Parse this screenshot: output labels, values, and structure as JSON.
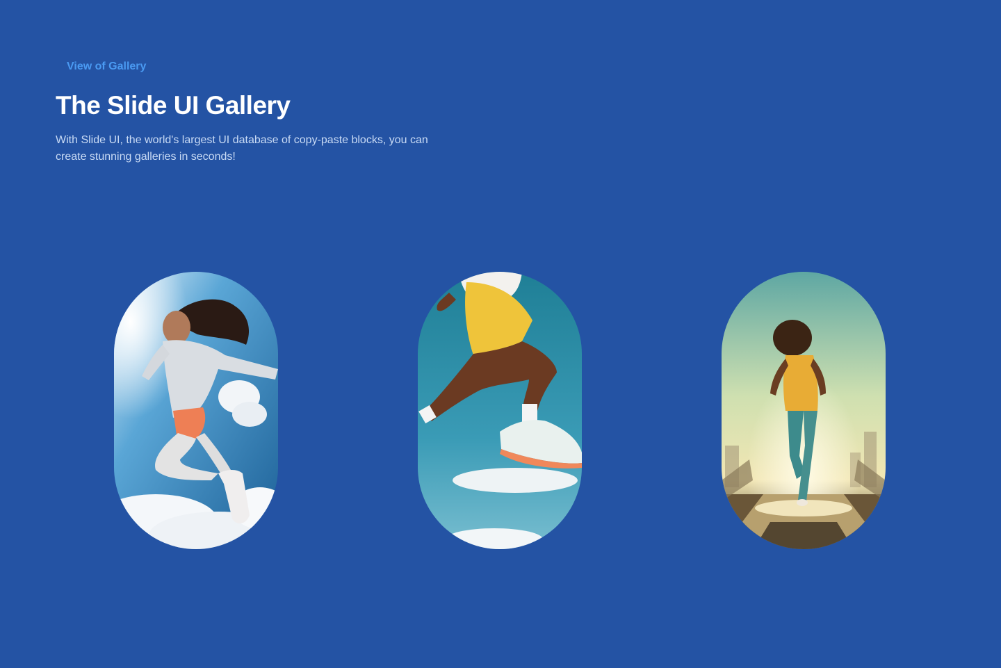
{
  "header": {
    "eyebrow": "View of Gallery",
    "title": "The Slide UI Gallery",
    "subtitle": "With Slide UI, the world's largest UI database of copy-paste blocks, you can create stunning galleries in seconds!"
  },
  "colors": {
    "background": "#2453a4",
    "accent": "#4a9af2",
    "title": "#ffffff",
    "subtitle": "#c9dbf5"
  },
  "gallery": {
    "images": [
      {
        "subject": "jumping-athlete-sky-image"
      },
      {
        "subject": "leaping-runner-legs-image"
      },
      {
        "subject": "running-woman-sunset-image"
      }
    ]
  }
}
